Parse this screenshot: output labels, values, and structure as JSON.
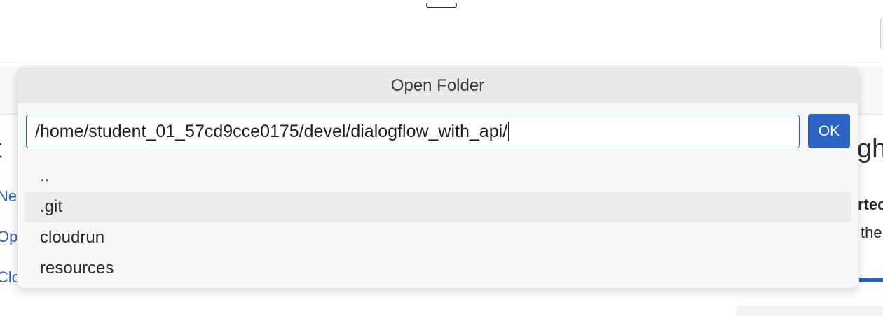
{
  "dialog": {
    "title": "Open Folder",
    "path_value": "/home/student_01_57cd9cce0175/devel/dialogflow_with_api/",
    "ok_label": "OK",
    "items": [
      {
        "label": ".."
      },
      {
        "label": ".git"
      },
      {
        "label": "cloudrun"
      },
      {
        "label": "resources"
      }
    ],
    "highlighted_index": 1
  },
  "background": {
    "left_heading_fragment": "t",
    "left_links": [
      "Ne",
      "Op",
      "Clo"
    ],
    "right_heading_fragment": "gh",
    "right_text_fragment_1": "rtec",
    "right_text_fragment_2": "the"
  },
  "colors": {
    "accent": "#2c63c4",
    "link": "#2760c8",
    "dialog_bg": "#f8f8f8",
    "header_bg": "#e9e9e9"
  }
}
